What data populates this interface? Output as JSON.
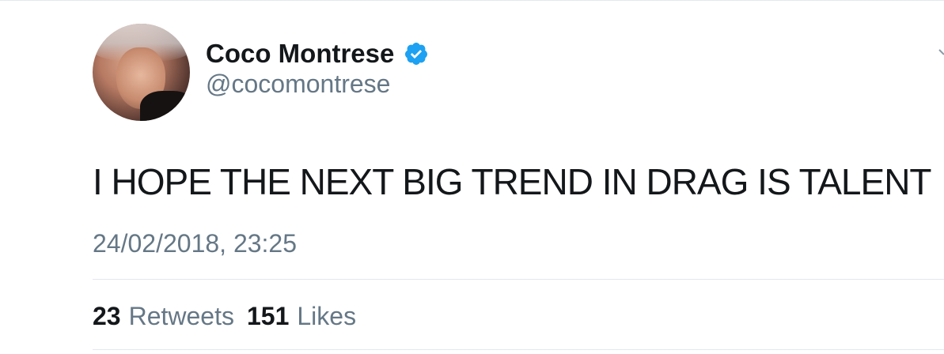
{
  "tweet": {
    "author": {
      "display_name": "Coco Montrese",
      "handle": "@cocomontrese",
      "verified": true,
      "avatar_icon": "profile-photo"
    },
    "text": "I HOPE THE NEXT BIG TREND IN DRAG IS TALENT",
    "timestamp": "24/02/2018, 23:25",
    "stats": {
      "retweets_count": "23",
      "retweets_label": "Retweets",
      "likes_count": "151",
      "likes_label": "Likes"
    }
  },
  "colors": {
    "verified_blue": "#1da1f2",
    "text_primary": "#14171a",
    "text_secondary": "#657786",
    "divider": "#e1e8ed"
  },
  "icons": {
    "verified": "verified-badge-icon",
    "menu": "chevron-down-icon"
  }
}
